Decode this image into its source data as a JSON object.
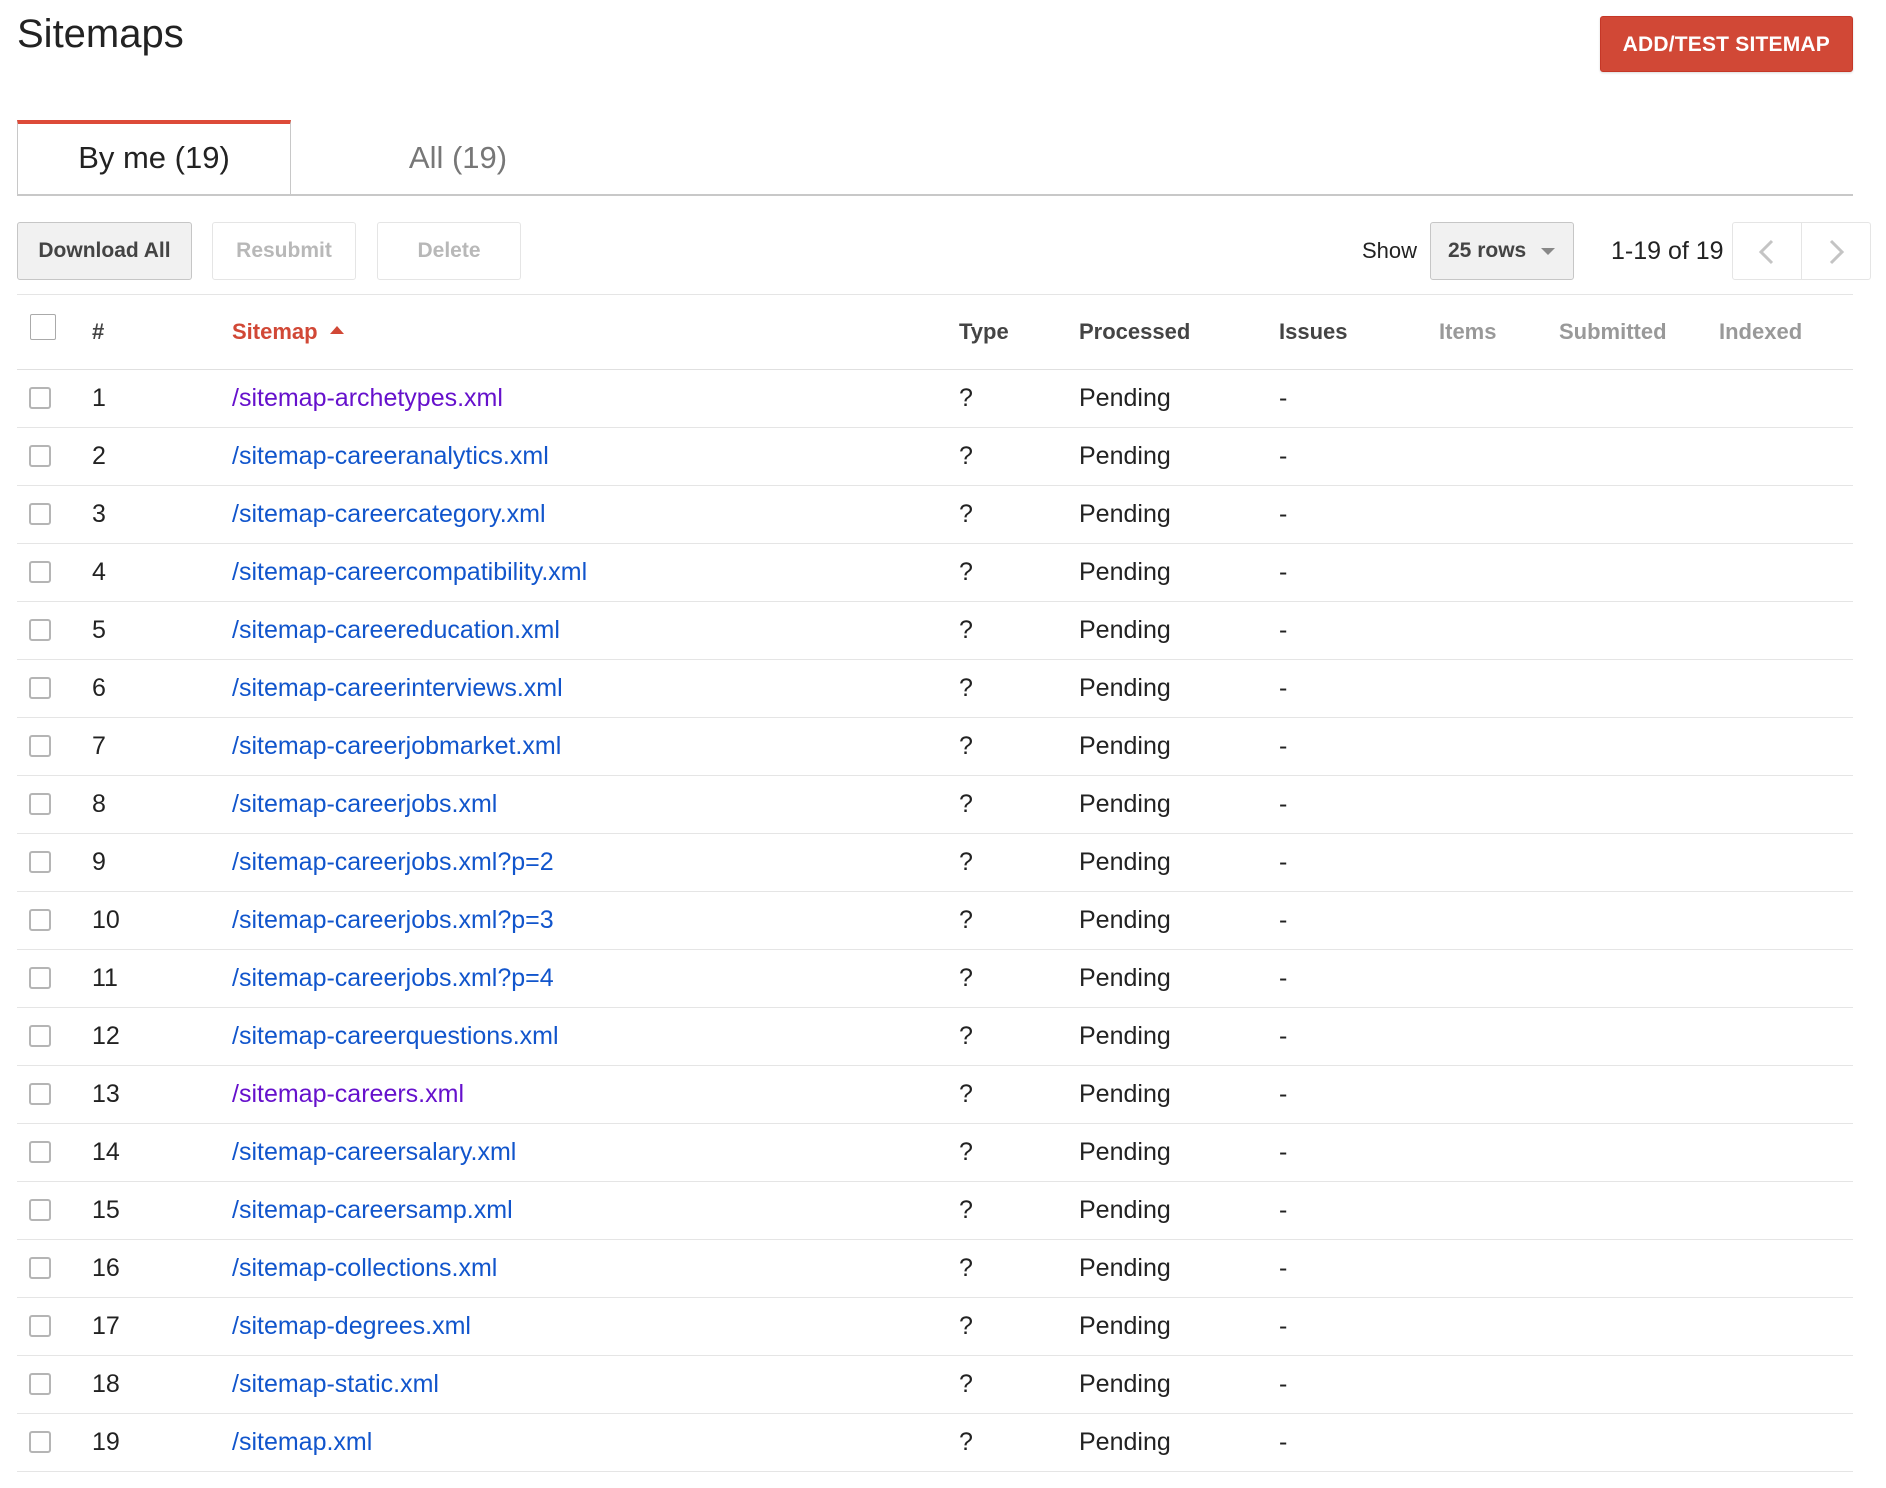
{
  "header": {
    "title": "Sitemaps",
    "add_button": "ADD/TEST SITEMAP"
  },
  "tabs": [
    {
      "label": "By me (19)",
      "active": true
    },
    {
      "label": "All (19)",
      "active": false
    }
  ],
  "toolbar": {
    "download_all": "Download All",
    "resubmit": "Resubmit",
    "delete": "Delete",
    "show_label": "Show",
    "rows_select": "25 rows",
    "range": "1-19 of 19"
  },
  "table": {
    "columns": {
      "num": "#",
      "sitemap": "Sitemap",
      "type": "Type",
      "processed": "Processed",
      "issues": "Issues",
      "items": "Items",
      "submitted": "Submitted",
      "indexed": "Indexed"
    },
    "rows": [
      {
        "num": "1",
        "sitemap": "/sitemap-archetypes.xml",
        "type": "?",
        "processed": "Pending",
        "issues": "-",
        "visited": true
      },
      {
        "num": "2",
        "sitemap": "/sitemap-careeranalytics.xml",
        "type": "?",
        "processed": "Pending",
        "issues": "-",
        "visited": false
      },
      {
        "num": "3",
        "sitemap": "/sitemap-careercategory.xml",
        "type": "?",
        "processed": "Pending",
        "issues": "-",
        "visited": false
      },
      {
        "num": "4",
        "sitemap": "/sitemap-careercompatibility.xml",
        "type": "?",
        "processed": "Pending",
        "issues": "-",
        "visited": false
      },
      {
        "num": "5",
        "sitemap": "/sitemap-careereducation.xml",
        "type": "?",
        "processed": "Pending",
        "issues": "-",
        "visited": false
      },
      {
        "num": "6",
        "sitemap": "/sitemap-careerinterviews.xml",
        "type": "?",
        "processed": "Pending",
        "issues": "-",
        "visited": false
      },
      {
        "num": "7",
        "sitemap": "/sitemap-careerjobmarket.xml",
        "type": "?",
        "processed": "Pending",
        "issues": "-",
        "visited": false
      },
      {
        "num": "8",
        "sitemap": "/sitemap-careerjobs.xml",
        "type": "?",
        "processed": "Pending",
        "issues": "-",
        "visited": false
      },
      {
        "num": "9",
        "sitemap": "/sitemap-careerjobs.xml?p=2",
        "type": "?",
        "processed": "Pending",
        "issues": "-",
        "visited": false
      },
      {
        "num": "10",
        "sitemap": "/sitemap-careerjobs.xml?p=3",
        "type": "?",
        "processed": "Pending",
        "issues": "-",
        "visited": false
      },
      {
        "num": "11",
        "sitemap": "/sitemap-careerjobs.xml?p=4",
        "type": "?",
        "processed": "Pending",
        "issues": "-",
        "visited": false
      },
      {
        "num": "12",
        "sitemap": "/sitemap-careerquestions.xml",
        "type": "?",
        "processed": "Pending",
        "issues": "-",
        "visited": false
      },
      {
        "num": "13",
        "sitemap": "/sitemap-careers.xml",
        "type": "?",
        "processed": "Pending",
        "issues": "-",
        "visited": true
      },
      {
        "num": "14",
        "sitemap": "/sitemap-careersalary.xml",
        "type": "?",
        "processed": "Pending",
        "issues": "-",
        "visited": false
      },
      {
        "num": "15",
        "sitemap": "/sitemap-careersamp.xml",
        "type": "?",
        "processed": "Pending",
        "issues": "-",
        "visited": false
      },
      {
        "num": "16",
        "sitemap": "/sitemap-collections.xml",
        "type": "?",
        "processed": "Pending",
        "issues": "-",
        "visited": false
      },
      {
        "num": "17",
        "sitemap": "/sitemap-degrees.xml",
        "type": "?",
        "processed": "Pending",
        "issues": "-",
        "visited": false
      },
      {
        "num": "18",
        "sitemap": "/sitemap-static.xml",
        "type": "?",
        "processed": "Pending",
        "issues": "-",
        "visited": false
      },
      {
        "num": "19",
        "sitemap": "/sitemap.xml",
        "type": "?",
        "processed": "Pending",
        "issues": "-",
        "visited": false
      }
    ]
  },
  "colors": {
    "accent_red": "#d14836",
    "link_blue": "#1155cc",
    "link_visited": "#6611cc"
  }
}
